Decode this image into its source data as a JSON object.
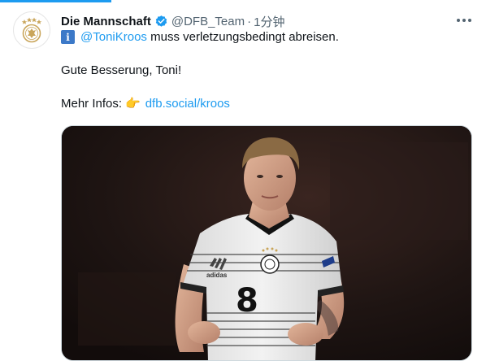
{
  "tweet": {
    "author_name": "Die Mannschaft",
    "handle": "@DFB_Team",
    "separator": "·",
    "time": "1分钟",
    "more_icon": "more-horizontal-icon",
    "info_glyph": "i",
    "mention": "@ToniKroos",
    "line1_rest": " muss verletzungsbedingt abreisen.",
    "line2": "Gute Besserung, Toni!",
    "line3_prefix": "Mehr Infos:",
    "point_emoji": "👉",
    "link": "dfb.social/kroos"
  },
  "media": {
    "jersey_number": "8",
    "brand": "adidas"
  },
  "colors": {
    "accent": "#1d9bf0",
    "info_badge": "#3c79c8",
    "secondary_text": "#536471"
  }
}
